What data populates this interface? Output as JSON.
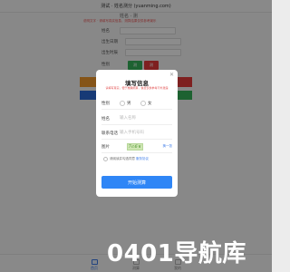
{
  "page": {
    "title": "测试 · 姓名测分 (yuanming.com)",
    "top_name": "姓名 · 测",
    "notice": "说明文字 · 请填写真实信息，测算结果仅供参考娱乐"
  },
  "background_form": {
    "rows": [
      {
        "label": "姓名"
      },
      {
        "label": "出生日期"
      },
      {
        "label": "出生时辰"
      },
      {
        "label": "性别"
      }
    ],
    "chips": [
      {
        "label": "测",
        "color": "#35b35a"
      },
      {
        "label": "测",
        "color": "#e53b3b"
      }
    ]
  },
  "modal": {
    "title": "填写信息",
    "hint": "请填写真实，便于准确测算，信息仅供参考不外泄露",
    "close_icon": "close-icon",
    "gender": {
      "label": "性别",
      "options": [
        "男",
        "女"
      ]
    },
    "name": {
      "label": "姓名",
      "placeholder": "输入名称"
    },
    "phone": {
      "label": "联系电话",
      "placeholder": "输入手机号码"
    },
    "captcha": {
      "label": "图片",
      "code": "7c6∨",
      "refresh_label": "换一张"
    },
    "agreement": {
      "text": "请阅读并勾选同意",
      "link": "服务协议"
    },
    "submit_label": "开始测算"
  },
  "bottom_nav": {
    "items": [
      {
        "label": "首页",
        "icon": "home-icon"
      },
      {
        "label": "测算",
        "icon": "grid-icon"
      },
      {
        "label": "我的",
        "icon": "user-icon"
      }
    ]
  },
  "watermark": "0401导航库",
  "colors": {
    "accent": "#2f86f6",
    "hint": "#e14b4b",
    "link": "#3d7be8"
  }
}
